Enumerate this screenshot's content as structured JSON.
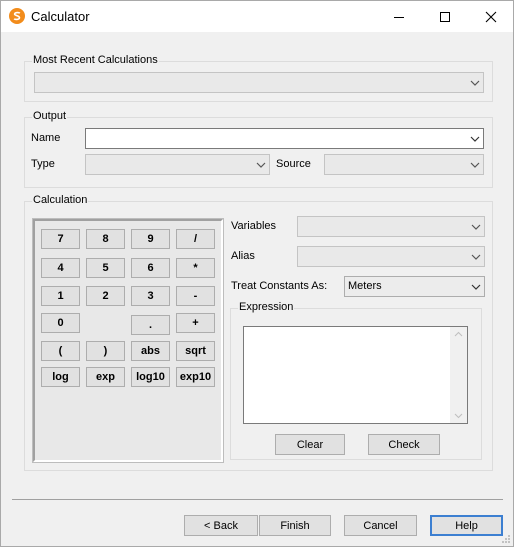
{
  "window": {
    "title": "Calculator"
  },
  "groups": {
    "recent": {
      "label": "Most Recent Calculations",
      "value": ""
    },
    "output": {
      "label": "Output",
      "name_label": "Name",
      "name_value": "",
      "type_label": "Type",
      "type_value": "",
      "source_label": "Source",
      "source_value": ""
    },
    "calculation": {
      "label": "Calculation",
      "variables_label": "Variables",
      "variables_value": "",
      "alias_label": "Alias",
      "alias_value": "",
      "treat_label": "Treat Constants As:",
      "treat_value": "Meters",
      "expression_label": "Expression",
      "expression_value": "",
      "clear_label": "Clear",
      "check_label": "Check"
    }
  },
  "keypad": {
    "k7": "7",
    "k8": "8",
    "k9": "9",
    "kdiv": "/",
    "k4": "4",
    "k5": "5",
    "k6": "6",
    "kmul": "*",
    "k1": "1",
    "k2": "2",
    "k3": "3",
    "ksub": "-",
    "k0": "0",
    "kdot": ".",
    "kadd": "+",
    "klparen": "(",
    "krparen": ")",
    "kabs": "abs",
    "ksqrt": "sqrt",
    "klog": "log",
    "kexp": "exp",
    "klog10": "log10",
    "kexp10": "exp10"
  },
  "footer": {
    "back": "< Back",
    "finish": "Finish",
    "cancel": "Cancel",
    "help": "Help"
  },
  "colors": {
    "accent": "#3c7fd1",
    "app_icon": "#f28c1b"
  },
  "icons": [
    "app-icon",
    "minimize-icon",
    "maximize-icon",
    "close-icon",
    "chevron-down-icon"
  ]
}
